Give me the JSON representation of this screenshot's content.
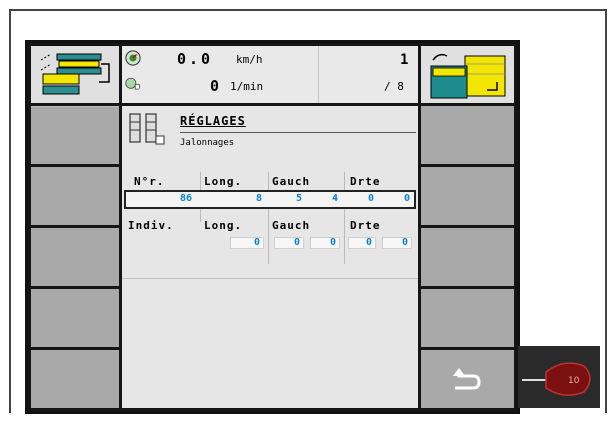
{
  "status": {
    "speed_value": "0.0",
    "speed_unit": "km/h",
    "rpm_value": "0",
    "rpm_unit": "1/min",
    "page_current": "1",
    "page_total": "/ 8"
  },
  "header": {
    "title": "RÉGLAGES",
    "subtitle": "Jalonnages"
  },
  "table": {
    "row1_headers": [
      "N°r.",
      "Long.",
      "Gauch",
      "Drte"
    ],
    "row1_values": [
      "86",
      "8",
      "5",
      "4",
      "0",
      "0"
    ],
    "row2_headers": [
      "Indiv.",
      "Long.",
      "Gauch",
      "Drte"
    ],
    "row2_values": [
      "0",
      "0",
      "0",
      "0",
      "0"
    ]
  },
  "thumbnail": {
    "label": "10"
  },
  "icons": {
    "top_left": "tramline-machine-icon",
    "top_right": "tramline-field-icon",
    "speed": "speedometer-icon",
    "rpm": "rpm-sensor-icon",
    "settings": "tramline-settings-icon",
    "back": "back-arrow-icon",
    "thumb": "control-knob-icon"
  },
  "colors": {
    "value_blue": "#0a83d6",
    "yellow": "#f2e600",
    "teal": "#1e8c8c"
  }
}
